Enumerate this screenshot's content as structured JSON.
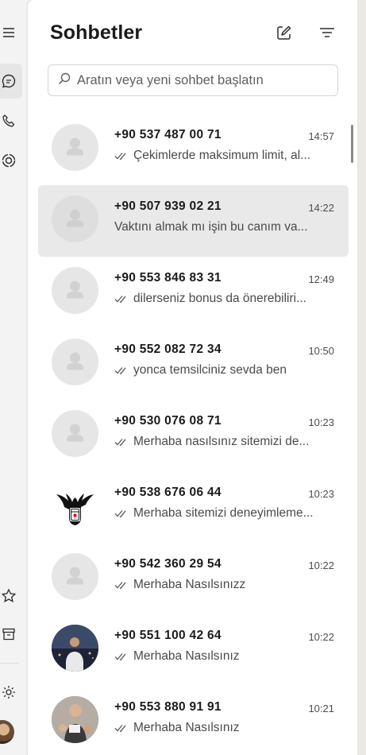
{
  "header": {
    "title": "Sohbetler",
    "new_chat_icon": "compose-icon",
    "filter_icon": "filter-icon"
  },
  "search": {
    "placeholder": "Aratın veya yeni sohbet başlatın",
    "icon": "search-icon"
  },
  "rail": {
    "items": [
      "menu-icon",
      "chats-icon",
      "calls-icon",
      "status-icon",
      "starred-icon",
      "archive-icon",
      "settings-icon",
      "profile-avatar"
    ]
  },
  "chats": [
    {
      "name": "+90 537 487 00 71",
      "time": "14:57",
      "preview": "Çekimlerde maksimum limit, al...",
      "read": true,
      "avatar": "default",
      "selected": false
    },
    {
      "name": "+90 507 939 02 21",
      "time": "14:22",
      "preview": "Vaktını almak mı  işin bu canım va...",
      "read": false,
      "avatar": "default",
      "selected": true
    },
    {
      "name": "+90 553 846 83 31",
      "time": "12:49",
      "preview": "dilerseniz bonus da önerebiliri...",
      "read": true,
      "avatar": "default",
      "selected": false
    },
    {
      "name": "+90 552 082 72 34",
      "time": "10:50",
      "preview": "yonca temsilciniz sevda ben",
      "read": true,
      "avatar": "default",
      "selected": false
    },
    {
      "name": "+90 530 076 08 71",
      "time": "10:23",
      "preview": "Merhaba nasılsınız  sitemizi de...",
      "read": true,
      "avatar": "default",
      "selected": false
    },
    {
      "name": "+90 538 676 06 44",
      "time": "10:23",
      "preview": "Merhaba sitemizi deneyimleme...",
      "read": true,
      "avatar": "eagle-logo",
      "selected": false
    },
    {
      "name": "+90 542 360 29 54",
      "time": "10:22",
      "preview": "Merhaba Nasılsınızz",
      "read": true,
      "avatar": "default",
      "selected": false
    },
    {
      "name": "+90 551 100 42 64",
      "time": "10:22",
      "preview": "Merhaba Nasılsınız",
      "read": true,
      "avatar": "photo-person",
      "selected": false
    },
    {
      "name": "+90 553 880 91 91",
      "time": "10:21",
      "preview": "Merhaba Nasılsınız",
      "read": true,
      "avatar": "photo-group",
      "selected": false
    }
  ]
}
